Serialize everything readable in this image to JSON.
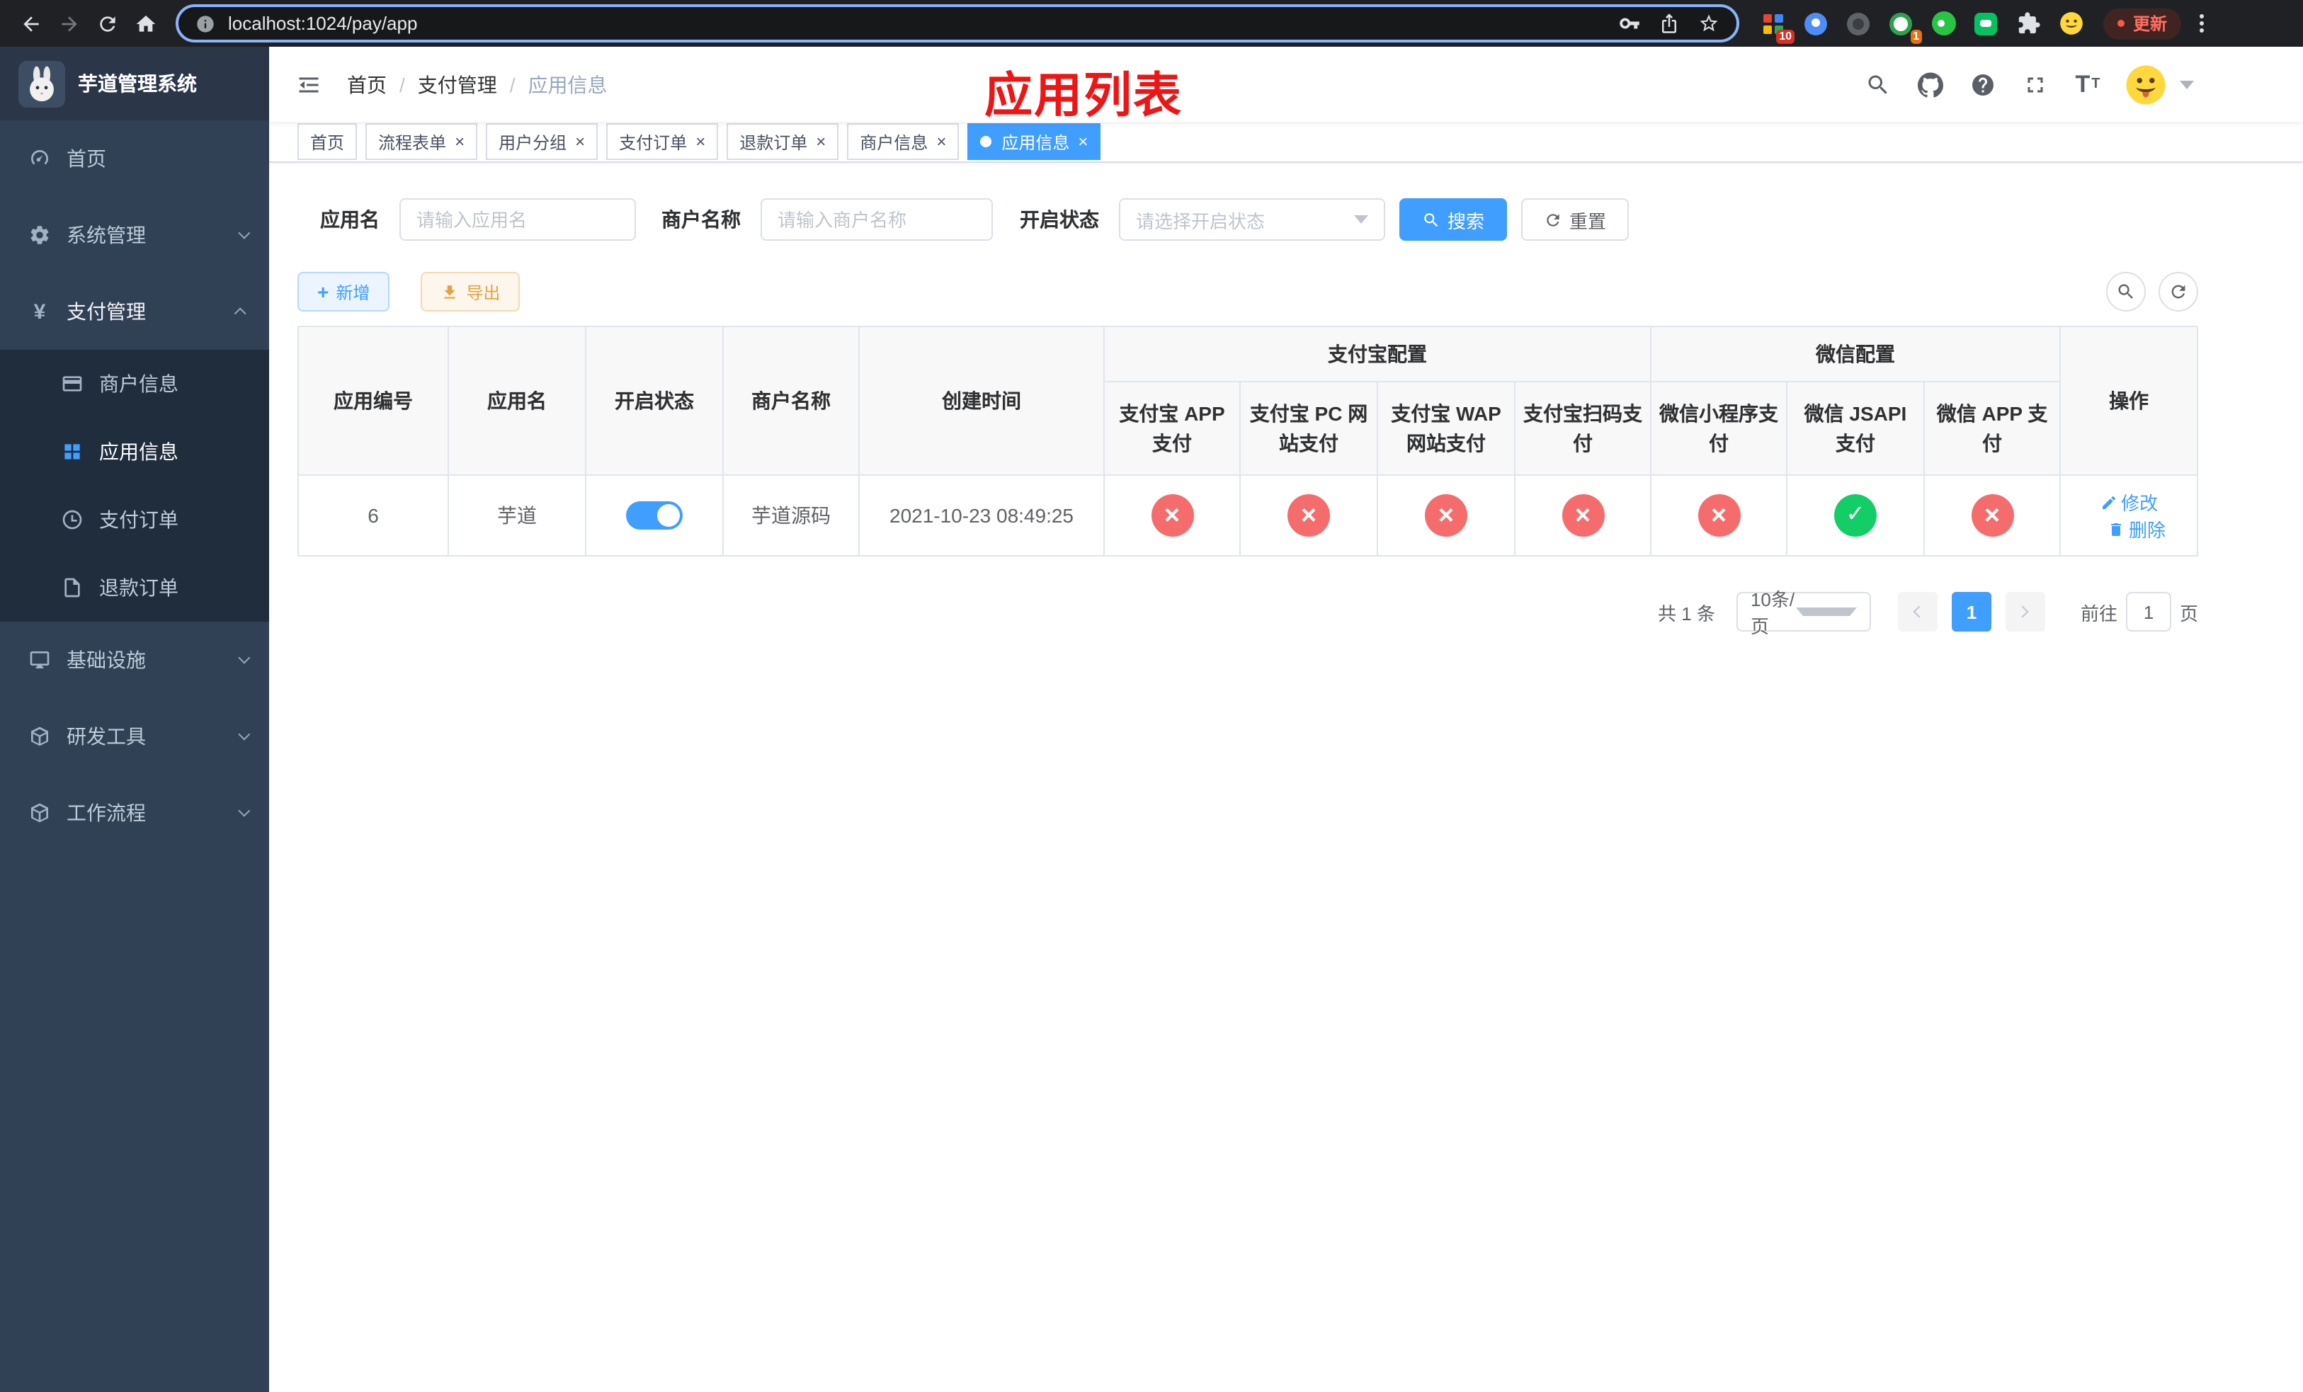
{
  "colors": {
    "accent_blue": "#409EFF",
    "title_red": "#f01414",
    "cross_red": "#f56c6c",
    "check_green": "#13ce66",
    "sidebar_bg": "#304156",
    "submenu_bg": "#1f2d3d",
    "export_orange": "#e6a23c"
  },
  "icons": {
    "close": "×",
    "plus": "+",
    "yen": "¥"
  },
  "browser": {
    "url": "localhost:1024/pay/app",
    "update_label": "更新",
    "extensions_badge": "10",
    "profile_badge": "1"
  },
  "sidebar": {
    "title": "芋道管理系统",
    "menu": [
      {
        "label": "首页"
      },
      {
        "label": "系统管理"
      },
      {
        "label": "支付管理"
      },
      {
        "label": "基础设施"
      },
      {
        "label": "研发工具"
      },
      {
        "label": "工作流程"
      }
    ],
    "submenu": [
      {
        "label": "商户信息"
      },
      {
        "label": "应用信息"
      },
      {
        "label": "支付订单"
      },
      {
        "label": "退款订单"
      }
    ]
  },
  "navbar": {
    "breadcrumb": [
      "首页",
      "支付管理",
      "应用信息"
    ],
    "page_title": "应用列表"
  },
  "tabs": [
    {
      "label": "首页"
    },
    {
      "label": "流程表单"
    },
    {
      "label": "用户分组"
    },
    {
      "label": "支付订单"
    },
    {
      "label": "退款订单"
    },
    {
      "label": "商户信息"
    },
    {
      "label": "应用信息"
    }
  ],
  "filters": {
    "app_name": {
      "label": "应用名",
      "placeholder": "请输入应用名"
    },
    "merchant_name": {
      "label": "商户名称",
      "placeholder": "请输入商户名称"
    },
    "status": {
      "label": "开启状态",
      "placeholder": "请选择开启状态"
    },
    "search_label": "搜索",
    "reset_label": "重置"
  },
  "toolbar": {
    "add_label": "新增",
    "export_label": "导出"
  },
  "table": {
    "groups": {
      "alipay": "支付宝配置",
      "wechat": "微信配置"
    },
    "columns": {
      "id": "应用编号",
      "name": "应用名",
      "status": "开启状态",
      "merchant": "商户名称",
      "created": "创建时间",
      "alipay_app": "支付宝 APP 支付",
      "alipay_pc": "支付宝 PC 网站支付",
      "alipay_wap": "支付宝 WAP 网站支付",
      "alipay_qr": "支付宝扫码支付",
      "wx_mini": "微信小程序支付",
      "wx_jsapi": "微信 JSAPI 支付",
      "wx_app": "微信 APP 支付",
      "actions": "操作"
    },
    "row": {
      "id": "6",
      "name": "芋道",
      "enabled": "on",
      "merchant": "芋道源码",
      "created": "2021-10-23 08:49:25",
      "statuses": [
        "cross",
        "cross",
        "cross",
        "cross",
        "cross",
        "check",
        "cross"
      ]
    },
    "edit_label": "修改",
    "delete_label": "删除"
  },
  "pagination": {
    "total": "共 1 条",
    "page_size": "10条/页",
    "page": "1",
    "goto_label": "前往",
    "goto_value": "1",
    "page_suffix": "页"
  }
}
